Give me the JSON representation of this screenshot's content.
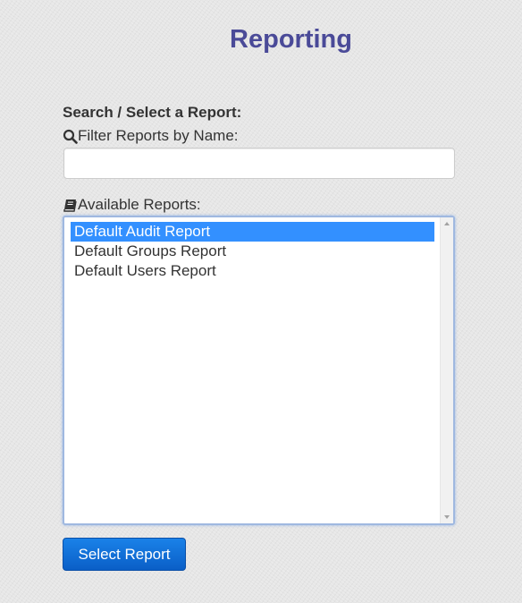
{
  "page": {
    "title": "Reporting"
  },
  "search": {
    "heading": "Search / Select a Report:",
    "filter_label": "Filter Reports by Name:",
    "filter_value": "",
    "filter_icon": "search-icon"
  },
  "reports": {
    "label": "Available Reports:",
    "label_icon": "book-icon",
    "items": [
      {
        "label": "Default Audit Report",
        "selected": true
      },
      {
        "label": "Default Groups Report",
        "selected": false
      },
      {
        "label": "Default Users Report",
        "selected": false
      }
    ]
  },
  "actions": {
    "select_label": "Select Report"
  },
  "colors": {
    "title": "#4a4a98",
    "selection": "#3390ff",
    "button": "#0a6fd8"
  }
}
